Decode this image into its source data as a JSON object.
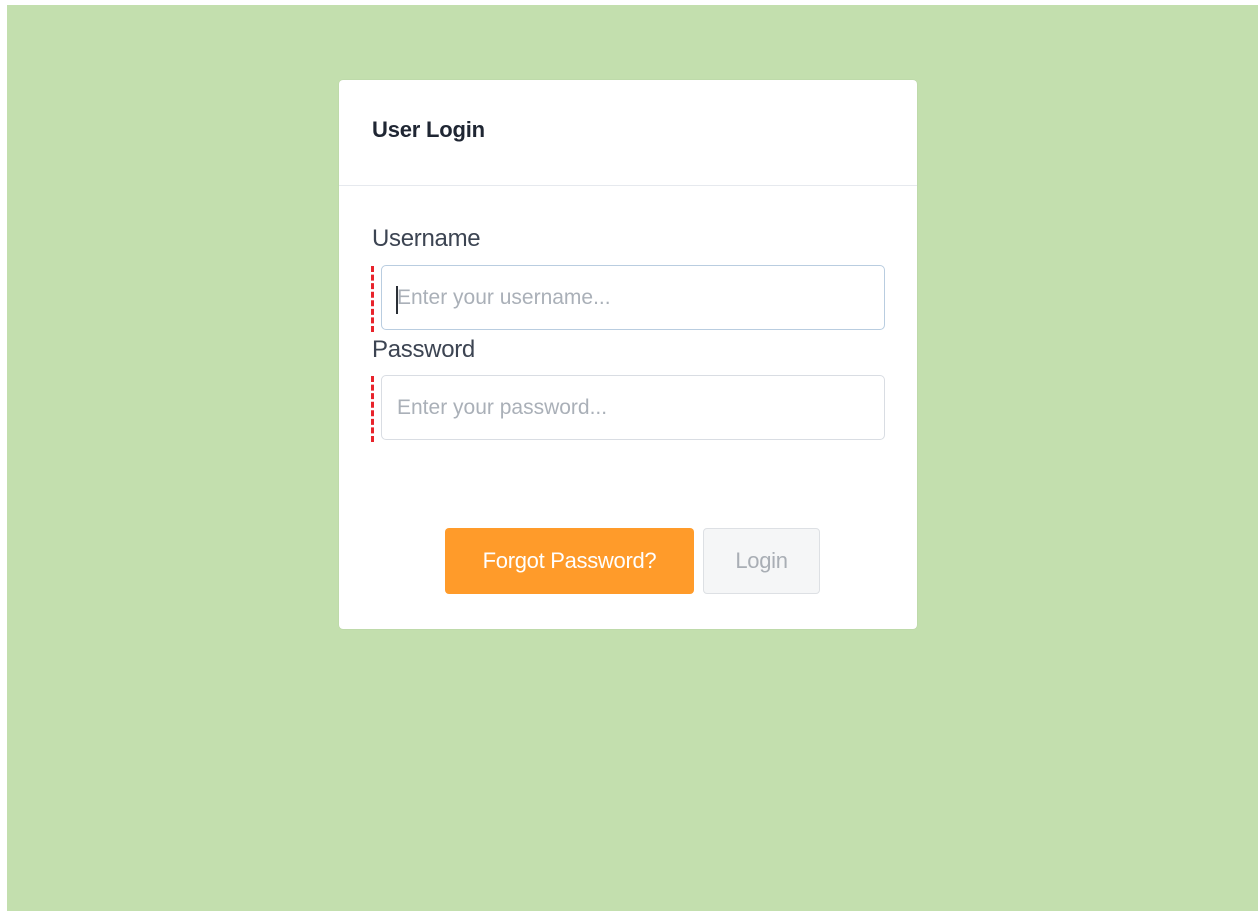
{
  "login_card": {
    "title": "User Login",
    "username": {
      "label": "Username",
      "placeholder": "Enter your username...",
      "value": ""
    },
    "password": {
      "label": "Password",
      "placeholder": "Enter your password...",
      "value": ""
    },
    "buttons": {
      "forgot_label": "Forgot Password?",
      "login_label": "Login"
    }
  },
  "colors": {
    "page_background": "#c3dfae",
    "forgot_button": "#ff9b2a",
    "required_marker": "#e8232b"
  }
}
